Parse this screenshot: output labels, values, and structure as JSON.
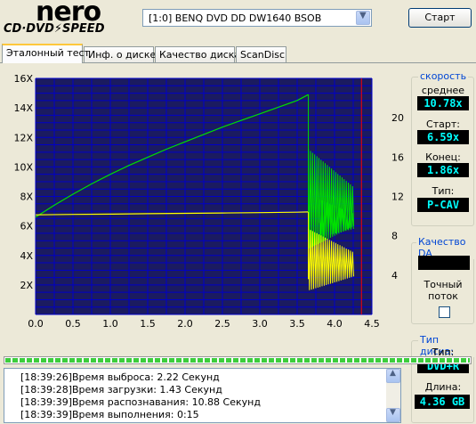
{
  "logo": {
    "brand": "nero",
    "product": "CD·DVD⚡SPEED"
  },
  "drive": {
    "selected": "[1:0]   BENQ DVD DD DW1640 BSOB"
  },
  "start_button": "Старт",
  "tabs": [
    {
      "label": "Эталонный тест",
      "active": true
    },
    {
      "label": "Инф. о диске",
      "active": false
    },
    {
      "label": "Качество диска",
      "active": false
    },
    {
      "label": "ScanDisc",
      "active": false
    }
  ],
  "speed_panel": {
    "title": "скорость",
    "avg_label": "среднее",
    "avg_value": "10.78x",
    "start_label": "Старт:",
    "start_value": "6.59x",
    "end_label": "Конец:",
    "end_value": "1.86x",
    "type_label": "Тип:",
    "type_value": "P-CAV"
  },
  "quality_panel": {
    "title": "Качество DA",
    "accurate_label_1": "Точный",
    "accurate_label_2": "поток",
    "accurate_checked": false
  },
  "disc_panel": {
    "title": "Тип диска:",
    "type_label": "Тип:",
    "type_value": "DVD+R",
    "length_label": "Длина:",
    "length_value": "4.36 GB"
  },
  "progress": {
    "percent": 100
  },
  "log": [
    {
      "time": "[18:39:26]",
      "text": "Время выброса: 2.22 Секунд"
    },
    {
      "time": "[18:39:28]",
      "text": "Время загрузки: 1.43 Секунд"
    },
    {
      "time": "[18:39:39]",
      "text": "Время распознавания: 10.88 Секунд"
    },
    {
      "time": "[18:39:39]",
      "text": "Время выполнения:  0:15"
    }
  ],
  "colors": {
    "chart_bg": "#1b1b60",
    "grid": "#0000c8",
    "green": "#00e000",
    "yellow": "#ffff00",
    "marker": "#ff0000",
    "accent_title": "#0046d5",
    "value_text": "#00ffff"
  },
  "chart_data": {
    "type": "line",
    "x_ticks": [
      "0.0",
      "0.5",
      "1.0",
      "1.5",
      "2.0",
      "2.5",
      "3.0",
      "3.5",
      "4.0",
      "4.5"
    ],
    "y_left_ticks": [
      "2X",
      "4X",
      "6X",
      "8X",
      "10X",
      "12X",
      "14X",
      "16X"
    ],
    "y_right_ticks": [
      "4",
      "8",
      "12",
      "16",
      "20"
    ],
    "xlim": [
      0,
      4.5
    ],
    "ylim_left": [
      0,
      16
    ],
    "ylim_right": [
      0,
      24
    ],
    "grid": true,
    "end_marker_x": 4.36,
    "series": [
      {
        "color": "green",
        "axis": "left",
        "x": [
          0,
          0.25,
          0.5,
          0.75,
          1.0,
          1.25,
          1.5,
          1.75,
          2.0,
          2.25,
          2.5,
          2.75,
          3.0,
          3.25,
          3.5,
          3.65
        ],
        "y": [
          6.6,
          7.4,
          8.15,
          8.85,
          9.5,
          10.1,
          10.65,
          11.2,
          11.7,
          12.2,
          12.7,
          13.15,
          13.6,
          14.05,
          14.5,
          14.9
        ]
      },
      {
        "color": "yellow",
        "axis": "left",
        "x": [
          0,
          0.5,
          1.0,
          1.5,
          2.0,
          2.5,
          3.0,
          3.5,
          3.65
        ],
        "y": [
          6.75,
          6.78,
          6.8,
          6.83,
          6.85,
          6.88,
          6.9,
          6.93,
          6.95
        ]
      }
    ]
  }
}
